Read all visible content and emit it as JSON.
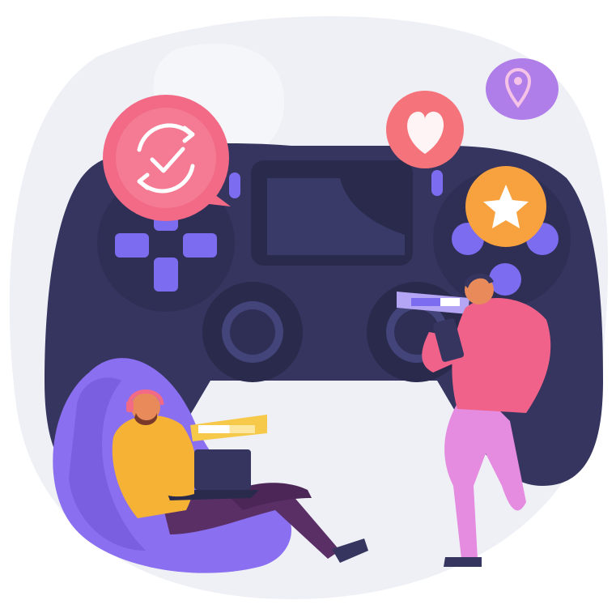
{
  "illustration": {
    "subject": "gamepad-with-players",
    "colors": {
      "background_blob": "#eef0f6",
      "controller": "#35355f",
      "controller_dark": "#2a2a4c",
      "controller_light": "#43447a",
      "button_purple": "#7b6cf0",
      "bubble_pink": "#f26a86",
      "bubble_coral": "#f5737a",
      "bubble_purple": "#b07ee8",
      "bubble_orange": "#f7a13f",
      "beanbag": "#8a6ff0",
      "shirt_yellow": "#f6b234",
      "shirt_pink": "#f0628a",
      "pants_purple": "#5a2f66",
      "pants_pink": "#e58be0",
      "skin": "#e98a5a",
      "loading_bar": "#f7c94a"
    },
    "icons": [
      "check-refresh-icon",
      "heart-icon",
      "location-pin-icon",
      "star-icon"
    ],
    "loading_bars": [
      {
        "name": "seated-player-progress",
        "progress": 0.55
      },
      {
        "name": "standing-player-progress",
        "progress": 0.6
      }
    ]
  }
}
